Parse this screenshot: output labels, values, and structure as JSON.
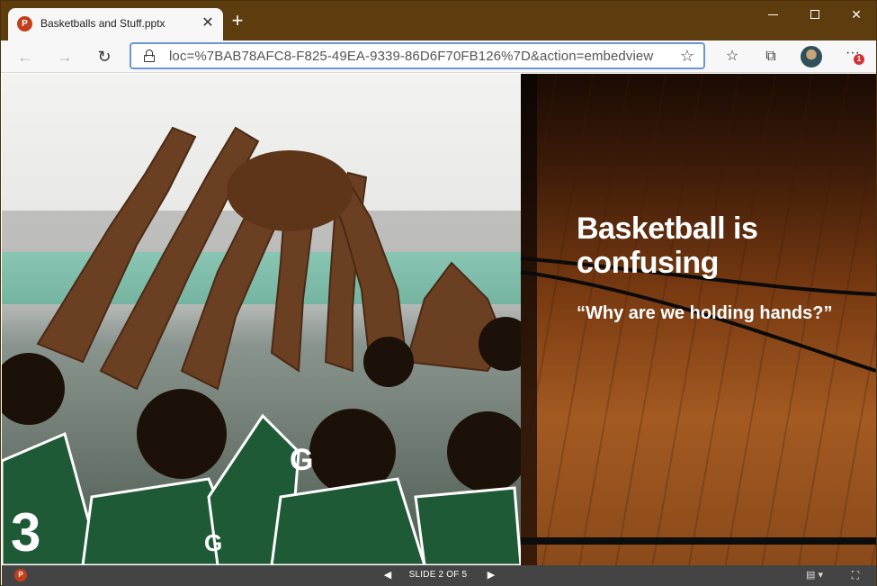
{
  "browser": {
    "tab_title": "Basketballs and Stuff.pptx",
    "tab_icon_letter": "P",
    "address_url": "loc=%7BAB78AFC8-F825-49EA-9339-86D6F70FB126%7D&action=embedview",
    "notification_count": "1"
  },
  "slide": {
    "title": "Basketball is confusing",
    "subtitle": "“Why are we holding hands?”"
  },
  "statusbar": {
    "slide_indicator": "SLIDE 2 OF 5"
  },
  "icons": {
    "tab_close": "close-icon",
    "new_tab": "plus-icon",
    "back": "back-arrow-icon",
    "forward": "forward-arrow-icon",
    "reload": "reload-icon",
    "lock": "lock-icon",
    "favorite": "star-icon",
    "favorites_list": "favorites-icon",
    "collections": "collections-icon",
    "more": "more-icon"
  }
}
